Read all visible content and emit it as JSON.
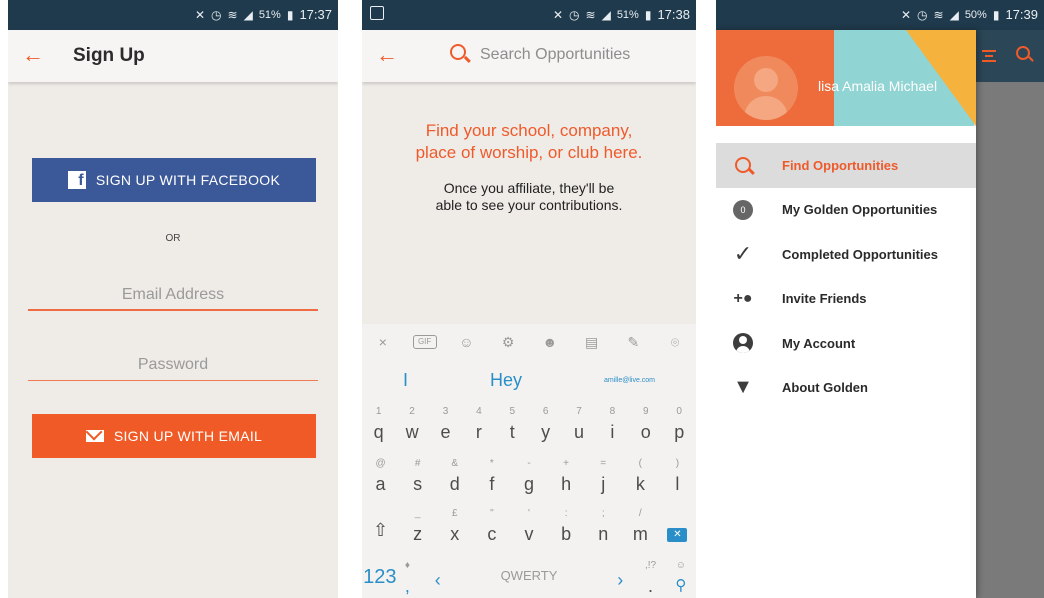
{
  "screens": {
    "signup": {
      "status": {
        "time": "17:37",
        "battery": "51%"
      },
      "toolbar": {
        "back": "←",
        "title": "Sign Up"
      },
      "facebook_button": "SIGN UP WITH FACEBOOK",
      "or_label": "OR",
      "email_placeholder": "Email Address",
      "password_placeholder": "Password",
      "email_button": "SIGN UP WITH EMAIL"
    },
    "search": {
      "status": {
        "time": "17:38",
        "battery": "51%"
      },
      "toolbar": {
        "back": "←",
        "search_placeholder": "Search Opportunities"
      },
      "heading": [
        "Find your school, company,",
        "place of worship, or club here."
      ],
      "body": [
        "Once you affiliate, they'll be",
        "able to see your contributions."
      ],
      "keyboard": {
        "toolbar_icons": [
          "×",
          "GIF",
          "sticker",
          "⚙",
          "emoji",
          "clipboard",
          "pin",
          "location"
        ],
        "suggestions": [
          "I",
          "Hey",
          "amille@live.com"
        ],
        "row1": [
          {
            "sub": "1",
            "main": "q"
          },
          {
            "sub": "2",
            "main": "w"
          },
          {
            "sub": "3",
            "main": "e"
          },
          {
            "sub": "4",
            "main": "r"
          },
          {
            "sub": "5",
            "main": "t"
          },
          {
            "sub": "6",
            "main": "y"
          },
          {
            "sub": "7",
            "main": "u"
          },
          {
            "sub": "8",
            "main": "i"
          },
          {
            "sub": "9",
            "main": "o"
          },
          {
            "sub": "0",
            "main": "p"
          }
        ],
        "row2": [
          {
            "sub": "@",
            "main": "a"
          },
          {
            "sub": "#",
            "main": "s"
          },
          {
            "sub": "&",
            "main": "d"
          },
          {
            "sub": "*",
            "main": "f"
          },
          {
            "sub": "-",
            "main": "g"
          },
          {
            "sub": "+",
            "main": "h"
          },
          {
            "sub": "=",
            "main": "j"
          },
          {
            "sub": "(",
            "main": "k"
          },
          {
            "sub": ")",
            "main": "l"
          }
        ],
        "row3": [
          {
            "sub": "_",
            "main": "z"
          },
          {
            "sub": "£",
            "main": "x"
          },
          {
            "sub": "\"",
            "main": "c"
          },
          {
            "sub": "'",
            "main": "v"
          },
          {
            "sub": ":",
            "main": "b"
          },
          {
            "sub": ";",
            "main": "n"
          },
          {
            "sub": "/",
            "main": "m"
          }
        ],
        "num_key": "123",
        "comma": ",",
        "space_label": "QWERTY",
        "left_arrow": "‹",
        "right_arrow": "›",
        "period_sub": ",!?",
        "period": "."
      }
    },
    "drawer": {
      "status": {
        "time": "17:39",
        "battery": "50%"
      },
      "user_name": "lisa Amalia Michael",
      "menu": [
        {
          "label": "Find Opportunities",
          "icon": "search-icon",
          "active": true
        },
        {
          "label": "My Golden Opportunities",
          "icon": "badge-icon",
          "badge": "0"
        },
        {
          "label": "Completed Opportunities",
          "icon": "check-icon",
          "glyph": "✓"
        },
        {
          "label": "Invite Friends",
          "icon": "add-people-icon",
          "glyph": "+"
        },
        {
          "label": "My Account",
          "icon": "account-icon"
        },
        {
          "label": "About Golden",
          "icon": "golden-logo-icon"
        }
      ]
    }
  },
  "colors": {
    "accent": "#ef5a2b",
    "facebook": "#3b5898",
    "statusbar": "#1f3a4c",
    "keyboard_accent": "#2a8fc8"
  }
}
